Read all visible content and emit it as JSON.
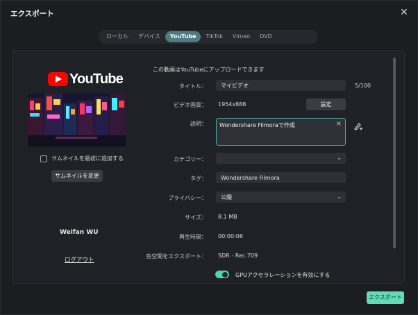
{
  "dialog": {
    "title": "エクスポート"
  },
  "tabs": [
    {
      "label": "ローカル"
    },
    {
      "label": "デバイス"
    },
    {
      "label": "YouTube"
    },
    {
      "label": "TikTok"
    },
    {
      "label": "Vimeo"
    },
    {
      "label": "DVD"
    }
  ],
  "active_tab": "YouTube",
  "left": {
    "logo_text": "YouTube",
    "thumbnail_checkbox_label": "サムネイルを最初に追加する",
    "thumbnail_checked": false,
    "change_thumbnail_label": "サムネイルを変更",
    "username": "Weifan WU",
    "logout_label": "ログアウト"
  },
  "form": {
    "heading": "この動画はYouTubeにアップロードできます",
    "title_label": "タイトル：",
    "title_value": "マイビデオ",
    "title_count": "5/100",
    "resolution_label": "ビデオ画質：",
    "resolution_value": "1954x888",
    "settings_label": "設定",
    "description_label": "説明：",
    "description_value": "Wondershare Filmoraで作成",
    "category_label": "カテゴリー：",
    "category_value": "",
    "tags_label": "タグ：",
    "tags_value": "Wondershare Filmora",
    "privacy_label": "プライバシー：",
    "privacy_value": "公開",
    "size_label": "サイズ：",
    "size_value": "8.1 MB",
    "duration_label": "再生時間：",
    "duration_value": "00:00:06",
    "colorspace_label": "色空間をエクスポート：",
    "colorspace_value": "SDR - Rec.709",
    "gpu_label": "GPUアクセラレーションを有効にする",
    "gpu_enabled": true
  },
  "footer": {
    "export_label": "エクスポート"
  },
  "colors": {
    "accent": "#62dcb6",
    "active_tab": "#4f7c83",
    "youtube_red": "#ff0000"
  },
  "icons": [
    "close-icon",
    "checkbox-icon",
    "chevron-down-icon",
    "clear-icon",
    "ai-text-icon",
    "toggle-icon"
  ]
}
